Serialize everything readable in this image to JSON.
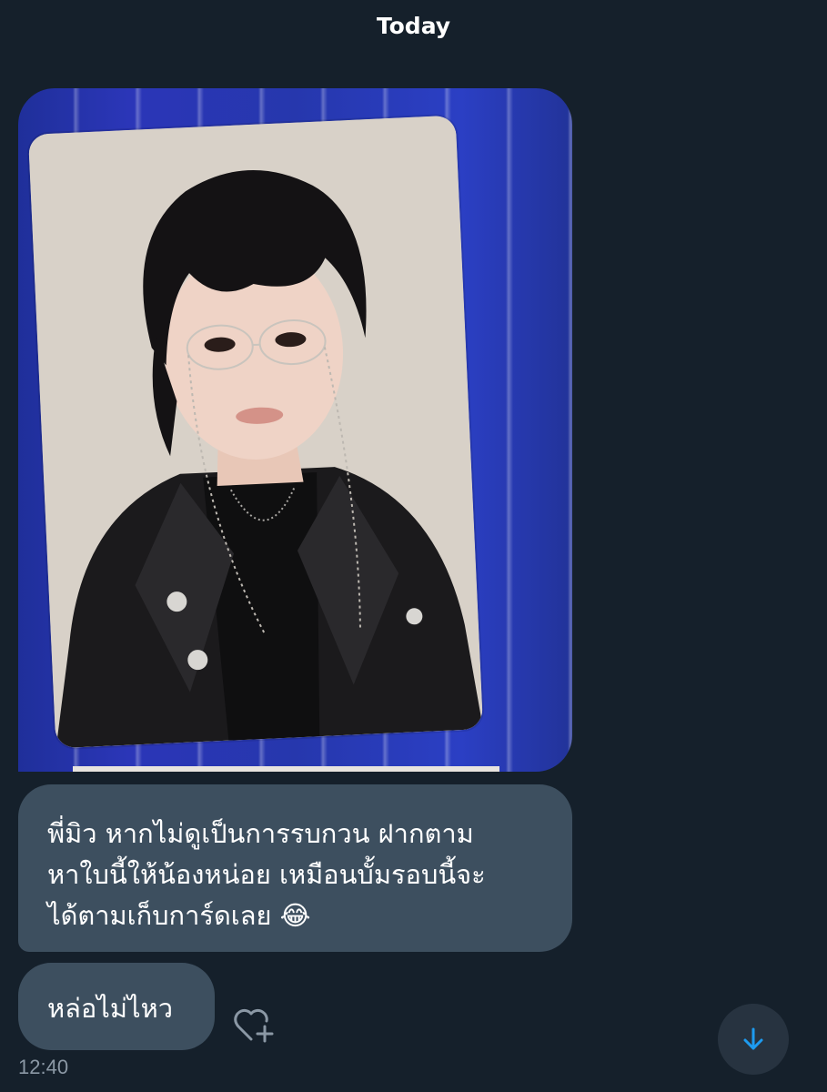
{
  "header": {
    "date_label": "Today"
  },
  "messages": [
    {
      "type": "image",
      "image_icon": "photocard-image"
    },
    {
      "type": "text",
      "lines": [
        "พี่มิว หากไม่ดูเป็นการรบกวน ฝากตาม",
        "หาใบนี้ให้น้องหน่อย เหมือนบั้มรอบนี้จะ",
        "ได้ตามเก็บการ์ดเลย 😂"
      ]
    },
    {
      "type": "text",
      "text": "หล่อไม่ไหว"
    }
  ],
  "message_meta": {
    "timestamp": "12:40",
    "react_icon": "heart-plus-icon"
  },
  "controls": {
    "scroll_down_icon": "arrow-down-icon"
  },
  "colors": {
    "background": "#15202b",
    "bubble": "#3d4f5f",
    "accent": "#1d9bf0",
    "muted_text": "#8b98a5"
  }
}
